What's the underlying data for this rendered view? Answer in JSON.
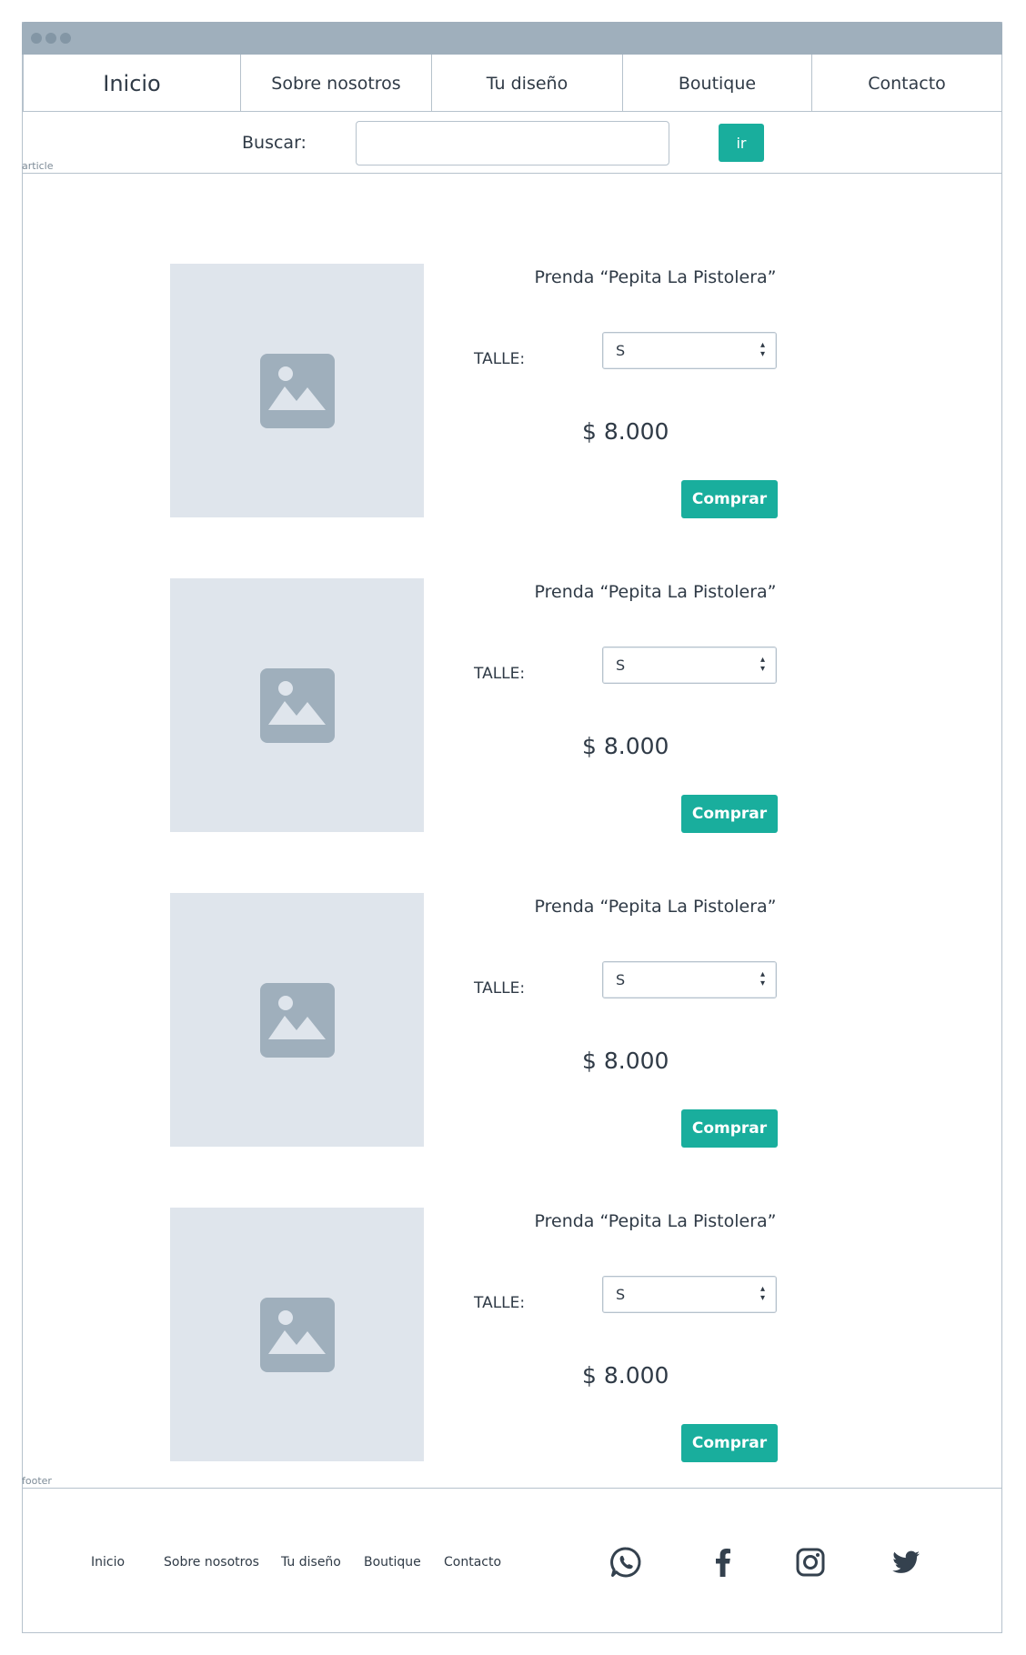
{
  "nav": {
    "items": [
      {
        "label": "Inicio"
      },
      {
        "label": "Sobre nosotros"
      },
      {
        "label": "Tu diseño"
      },
      {
        "label": "Boutique"
      },
      {
        "label": "Contacto"
      }
    ]
  },
  "search": {
    "label": "Buscar:",
    "value": "",
    "button_label": "ir"
  },
  "sections": {
    "article_label": "article",
    "footer_label": "footer"
  },
  "products": [
    {
      "title": "Prenda “Pepita La Pistolera”",
      "size_label": "TALLE:",
      "size_value": "S",
      "price": "$ 8.000",
      "buy_label": "Comprar"
    },
    {
      "title": "Prenda “Pepita La Pistolera”",
      "size_label": "TALLE:",
      "size_value": "S",
      "price": "$ 8.000",
      "buy_label": "Comprar"
    },
    {
      "title": "Prenda “Pepita La Pistolera”",
      "size_label": "TALLE:",
      "size_value": "S",
      "price": "$ 8.000",
      "buy_label": "Comprar"
    },
    {
      "title": "Prenda “Pepita La Pistolera”",
      "size_label": "TALLE:",
      "size_value": "S",
      "price": "$ 8.000",
      "buy_label": "Comprar"
    }
  ],
  "footer": {
    "links": [
      {
        "label": "Inicio"
      },
      {
        "label": "Sobre nosotros"
      },
      {
        "label": "Tu diseño"
      },
      {
        "label": "Boutique"
      },
      {
        "label": "Contacto"
      }
    ],
    "social_icons": [
      "whatsapp-icon",
      "facebook-icon",
      "instagram-icon",
      "twitter-icon"
    ]
  },
  "colors": {
    "accent": "#19ae9d",
    "titlebar": "#9fafbc",
    "placeholder_bg": "#dfe5ec",
    "placeholder_icon": "#9fafbc",
    "border": "#b6c2cc",
    "text": "#2f3a46"
  }
}
